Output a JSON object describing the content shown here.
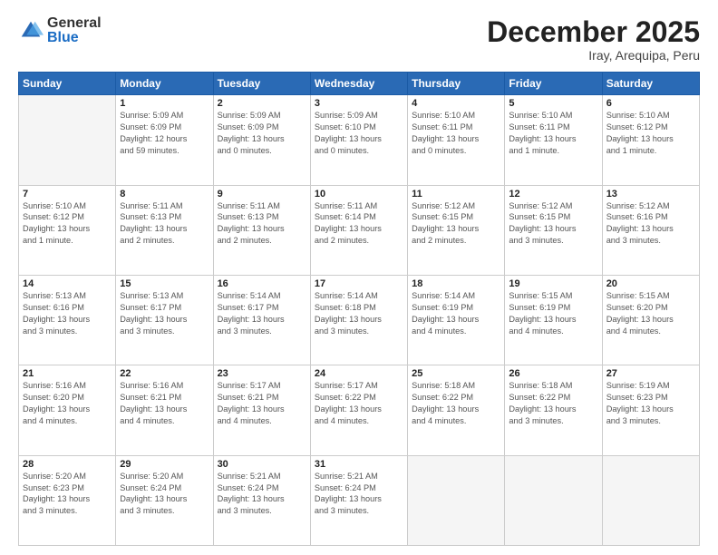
{
  "logo": {
    "general": "General",
    "blue": "Blue"
  },
  "header": {
    "month": "December 2025",
    "location": "Iray, Arequipa, Peru"
  },
  "weekdays": [
    "Sunday",
    "Monday",
    "Tuesday",
    "Wednesday",
    "Thursday",
    "Friday",
    "Saturday"
  ],
  "weeks": [
    [
      {
        "day": "",
        "info": ""
      },
      {
        "day": "1",
        "info": "Sunrise: 5:09 AM\nSunset: 6:09 PM\nDaylight: 12 hours\nand 59 minutes."
      },
      {
        "day": "2",
        "info": "Sunrise: 5:09 AM\nSunset: 6:09 PM\nDaylight: 13 hours\nand 0 minutes."
      },
      {
        "day": "3",
        "info": "Sunrise: 5:09 AM\nSunset: 6:10 PM\nDaylight: 13 hours\nand 0 minutes."
      },
      {
        "day": "4",
        "info": "Sunrise: 5:10 AM\nSunset: 6:11 PM\nDaylight: 13 hours\nand 0 minutes."
      },
      {
        "day": "5",
        "info": "Sunrise: 5:10 AM\nSunset: 6:11 PM\nDaylight: 13 hours\nand 1 minute."
      },
      {
        "day": "6",
        "info": "Sunrise: 5:10 AM\nSunset: 6:12 PM\nDaylight: 13 hours\nand 1 minute."
      }
    ],
    [
      {
        "day": "7",
        "info": "Sunrise: 5:10 AM\nSunset: 6:12 PM\nDaylight: 13 hours\nand 1 minute."
      },
      {
        "day": "8",
        "info": "Sunrise: 5:11 AM\nSunset: 6:13 PM\nDaylight: 13 hours\nand 2 minutes."
      },
      {
        "day": "9",
        "info": "Sunrise: 5:11 AM\nSunset: 6:13 PM\nDaylight: 13 hours\nand 2 minutes."
      },
      {
        "day": "10",
        "info": "Sunrise: 5:11 AM\nSunset: 6:14 PM\nDaylight: 13 hours\nand 2 minutes."
      },
      {
        "day": "11",
        "info": "Sunrise: 5:12 AM\nSunset: 6:15 PM\nDaylight: 13 hours\nand 2 minutes."
      },
      {
        "day": "12",
        "info": "Sunrise: 5:12 AM\nSunset: 6:15 PM\nDaylight: 13 hours\nand 3 minutes."
      },
      {
        "day": "13",
        "info": "Sunrise: 5:12 AM\nSunset: 6:16 PM\nDaylight: 13 hours\nand 3 minutes."
      }
    ],
    [
      {
        "day": "14",
        "info": "Sunrise: 5:13 AM\nSunset: 6:16 PM\nDaylight: 13 hours\nand 3 minutes."
      },
      {
        "day": "15",
        "info": "Sunrise: 5:13 AM\nSunset: 6:17 PM\nDaylight: 13 hours\nand 3 minutes."
      },
      {
        "day": "16",
        "info": "Sunrise: 5:14 AM\nSunset: 6:17 PM\nDaylight: 13 hours\nand 3 minutes."
      },
      {
        "day": "17",
        "info": "Sunrise: 5:14 AM\nSunset: 6:18 PM\nDaylight: 13 hours\nand 3 minutes."
      },
      {
        "day": "18",
        "info": "Sunrise: 5:14 AM\nSunset: 6:19 PM\nDaylight: 13 hours\nand 4 minutes."
      },
      {
        "day": "19",
        "info": "Sunrise: 5:15 AM\nSunset: 6:19 PM\nDaylight: 13 hours\nand 4 minutes."
      },
      {
        "day": "20",
        "info": "Sunrise: 5:15 AM\nSunset: 6:20 PM\nDaylight: 13 hours\nand 4 minutes."
      }
    ],
    [
      {
        "day": "21",
        "info": "Sunrise: 5:16 AM\nSunset: 6:20 PM\nDaylight: 13 hours\nand 4 minutes."
      },
      {
        "day": "22",
        "info": "Sunrise: 5:16 AM\nSunset: 6:21 PM\nDaylight: 13 hours\nand 4 minutes."
      },
      {
        "day": "23",
        "info": "Sunrise: 5:17 AM\nSunset: 6:21 PM\nDaylight: 13 hours\nand 4 minutes."
      },
      {
        "day": "24",
        "info": "Sunrise: 5:17 AM\nSunset: 6:22 PM\nDaylight: 13 hours\nand 4 minutes."
      },
      {
        "day": "25",
        "info": "Sunrise: 5:18 AM\nSunset: 6:22 PM\nDaylight: 13 hours\nand 4 minutes."
      },
      {
        "day": "26",
        "info": "Sunrise: 5:18 AM\nSunset: 6:22 PM\nDaylight: 13 hours\nand 3 minutes."
      },
      {
        "day": "27",
        "info": "Sunrise: 5:19 AM\nSunset: 6:23 PM\nDaylight: 13 hours\nand 3 minutes."
      }
    ],
    [
      {
        "day": "28",
        "info": "Sunrise: 5:20 AM\nSunset: 6:23 PM\nDaylight: 13 hours\nand 3 minutes."
      },
      {
        "day": "29",
        "info": "Sunrise: 5:20 AM\nSunset: 6:24 PM\nDaylight: 13 hours\nand 3 minutes."
      },
      {
        "day": "30",
        "info": "Sunrise: 5:21 AM\nSunset: 6:24 PM\nDaylight: 13 hours\nand 3 minutes."
      },
      {
        "day": "31",
        "info": "Sunrise: 5:21 AM\nSunset: 6:24 PM\nDaylight: 13 hours\nand 3 minutes."
      },
      {
        "day": "",
        "info": ""
      },
      {
        "day": "",
        "info": ""
      },
      {
        "day": "",
        "info": ""
      }
    ]
  ]
}
